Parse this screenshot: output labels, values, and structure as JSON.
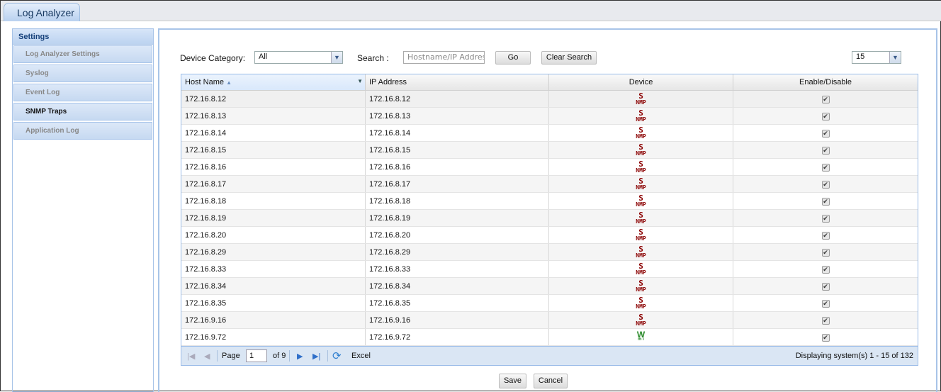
{
  "app": {
    "tab": "Log Analyzer"
  },
  "sidebar": {
    "heading": "Settings",
    "items": [
      {
        "label": "Log Analyzer Settings"
      },
      {
        "label": "Syslog"
      },
      {
        "label": "Event Log"
      },
      {
        "label": "SNMP Traps",
        "active": true
      },
      {
        "label": "Application Log"
      }
    ]
  },
  "filters": {
    "category_label": "Device Category:",
    "category_value": "All",
    "search_label": "Search :",
    "search_placeholder": "Hostname/IP Address",
    "go": "Go",
    "clear": "Clear Search",
    "page_size": "15"
  },
  "table": {
    "columns": [
      "Host Name",
      "IP Address",
      "Device",
      "Enable/Disable"
    ],
    "rows": [
      {
        "host": "172.16.8.12",
        "ip": "172.16.8.12",
        "device": "snmp",
        "enabled": true
      },
      {
        "host": "172.16.8.13",
        "ip": "172.16.8.13",
        "device": "snmp",
        "enabled": true
      },
      {
        "host": "172.16.8.14",
        "ip": "172.16.8.14",
        "device": "snmp",
        "enabled": true
      },
      {
        "host": "172.16.8.15",
        "ip": "172.16.8.15",
        "device": "snmp",
        "enabled": true
      },
      {
        "host": "172.16.8.16",
        "ip": "172.16.8.16",
        "device": "snmp",
        "enabled": true
      },
      {
        "host": "172.16.8.17",
        "ip": "172.16.8.17",
        "device": "snmp",
        "enabled": true
      },
      {
        "host": "172.16.8.18",
        "ip": "172.16.8.18",
        "device": "snmp",
        "enabled": true
      },
      {
        "host": "172.16.8.19",
        "ip": "172.16.8.19",
        "device": "snmp",
        "enabled": true
      },
      {
        "host": "172.16.8.20",
        "ip": "172.16.8.20",
        "device": "snmp",
        "enabled": true
      },
      {
        "host": "172.16.8.29",
        "ip": "172.16.8.29",
        "device": "snmp",
        "enabled": true
      },
      {
        "host": "172.16.8.33",
        "ip": "172.16.8.33",
        "device": "snmp",
        "enabled": true
      },
      {
        "host": "172.16.8.34",
        "ip": "172.16.8.34",
        "device": "snmp",
        "enabled": true
      },
      {
        "host": "172.16.8.35",
        "ip": "172.16.8.35",
        "device": "snmp",
        "enabled": true
      },
      {
        "host": "172.16.9.16",
        "ip": "172.16.9.16",
        "device": "snmp",
        "enabled": true
      },
      {
        "host": "172.16.9.72",
        "ip": "172.16.9.72",
        "device": "wmi",
        "enabled": true
      }
    ]
  },
  "pager": {
    "page_label": "Page",
    "page": "1",
    "of": "of 9",
    "excel": "Excel",
    "display": "Displaying system(s) 1 - 15 of 132"
  },
  "actions": {
    "save": "Save",
    "cancel": "Cancel"
  }
}
